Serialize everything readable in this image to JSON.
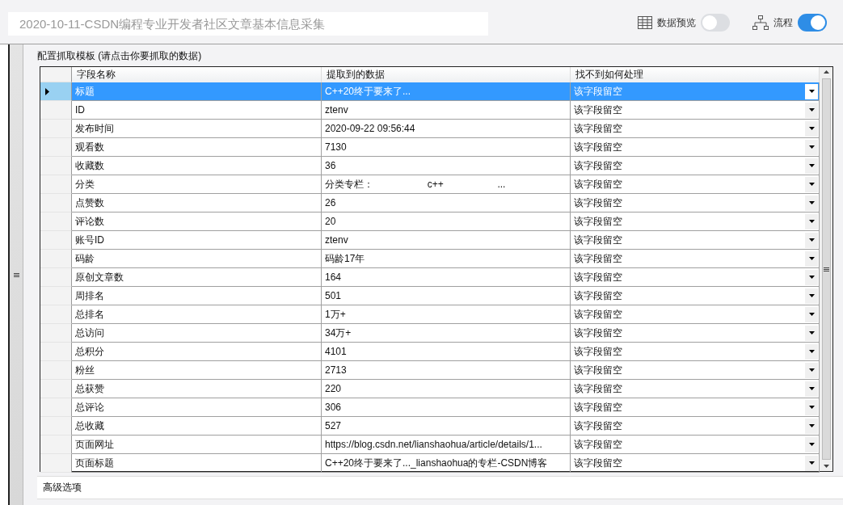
{
  "title_field": {
    "value": "2020-10-11-CSDN编程专业开发者社区文章基本信息采集"
  },
  "toolbar": [
    {
      "kind": "grid",
      "label": "数据预览",
      "on": false
    },
    {
      "kind": "flow",
      "label": "流程",
      "on": true
    }
  ],
  "section_label": "配置抓取模板 (请点击你要抓取的数据)",
  "table": {
    "columns": [
      "字段名称",
      "提取到的数据",
      "找不到如何处理"
    ],
    "rows": [
      {
        "field": "标题",
        "data": "C++20终于要来了...",
        "action": "该字段留空",
        "selected": true
      },
      {
        "field": "ID",
        "data": "ztenv",
        "action": "该字段留空",
        "selected": false
      },
      {
        "field": "发布时间",
        "data": "2020-09-22 09:56:44",
        "action": "该字段留空",
        "selected": false
      },
      {
        "field": "观看数",
        "data": "7130",
        "action": "该字段留空",
        "selected": false
      },
      {
        "field": "收藏数",
        "data": "36",
        "action": "该字段留空",
        "selected": false
      },
      {
        "field": "分类",
        "data": "分类专栏：                    c++                    ...",
        "action": "该字段留空",
        "selected": false
      },
      {
        "field": "点赞数",
        "data": "26",
        "action": "该字段留空",
        "selected": false
      },
      {
        "field": "评论数",
        "data": "20",
        "action": "该字段留空",
        "selected": false
      },
      {
        "field": "账号ID",
        "data": "ztenv",
        "action": "该字段留空",
        "selected": false
      },
      {
        "field": "码龄",
        "data": "码龄17年",
        "action": "该字段留空",
        "selected": false
      },
      {
        "field": "原创文章数",
        "data": "164",
        "action": "该字段留空",
        "selected": false
      },
      {
        "field": "周排名",
        "data": "501",
        "action": "该字段留空",
        "selected": false
      },
      {
        "field": "总排名",
        "data": "1万+",
        "action": "该字段留空",
        "selected": false
      },
      {
        "field": "总访问",
        "data": "34万+",
        "action": "该字段留空",
        "selected": false
      },
      {
        "field": "总积分",
        "data": "4101",
        "action": "该字段留空",
        "selected": false
      },
      {
        "field": "粉丝",
        "data": "2713",
        "action": "该字段留空",
        "selected": false
      },
      {
        "field": "总获赞",
        "data": "220",
        "action": "该字段留空",
        "selected": false
      },
      {
        "field": "总评论",
        "data": "306",
        "action": "该字段留空",
        "selected": false
      },
      {
        "field": "总收藏",
        "data": "527",
        "action": "该字段留空",
        "selected": false
      },
      {
        "field": "页面网址",
        "data": "https://blog.csdn.net/lianshaohua/article/details/1...",
        "action": "该字段留空",
        "selected": false
      },
      {
        "field": "页面标题",
        "data": "C++20终于要来了..._lianshaohua的专栏-CSDN博客",
        "action": "该字段留空",
        "selected": false
      }
    ]
  },
  "advanced": "高级选项"
}
